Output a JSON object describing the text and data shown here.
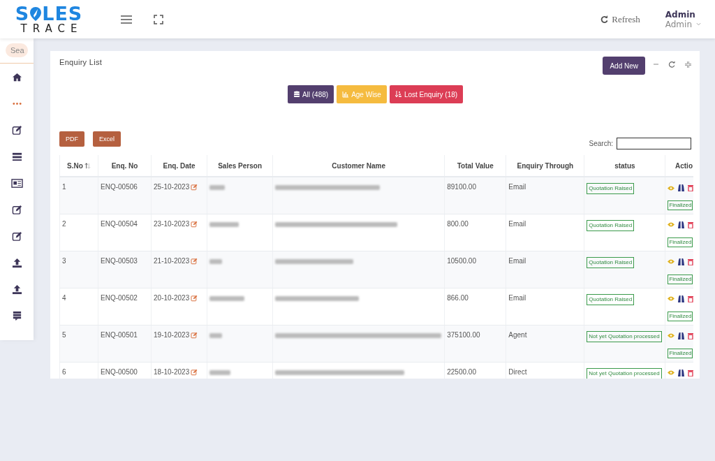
{
  "header": {
    "logo_left": "S",
    "logo_right": "LES",
    "logo_bottom": "TRACE",
    "refresh": "Refresh",
    "user_name": "Admin",
    "user_role": "Admin"
  },
  "sidebar": {
    "search_placeholder": "Sea",
    "items": [
      {
        "kind": "home"
      },
      {
        "kind": "dots"
      },
      {
        "kind": "edit"
      },
      {
        "kind": "list"
      },
      {
        "kind": "news"
      },
      {
        "kind": "edit"
      },
      {
        "kind": "edit"
      },
      {
        "kind": "upload"
      },
      {
        "kind": "upload"
      },
      {
        "kind": "stack"
      }
    ]
  },
  "card": {
    "title": "Enquiry List",
    "add_button": "Add New",
    "filters": [
      {
        "label": "All (488)",
        "kind": "database",
        "color": "#533f6e"
      },
      {
        "label": "Age Wise",
        "kind": "chart",
        "color": "#f5bb3f"
      },
      {
        "label": "Lost Enquiry (18)",
        "kind": "sort",
        "color": "#dc3d55"
      }
    ],
    "exports": [
      "PDF",
      "Excel"
    ],
    "search_label": "Search:",
    "columns": [
      "S.No",
      "Enq. No",
      "Enq. Date",
      "Sales Person",
      "Customer Name",
      "Total Value",
      "Enquiry Through",
      "status",
      "Actio"
    ],
    "rows": [
      {
        "sno": "1",
        "enq_no": "ENQ-00506",
        "date": "25-10-2023",
        "total": "89100.00",
        "through": "Email",
        "status": "Quotation Raised",
        "badge": "Finalized"
      },
      {
        "sno": "2",
        "enq_no": "ENQ-00504",
        "date": "23-10-2023",
        "total": "800.00",
        "through": "Email",
        "status": "Quotation Raised",
        "badge": "Finalized"
      },
      {
        "sno": "3",
        "enq_no": "ENQ-00503",
        "date": "21-10-2023",
        "total": "10500.00",
        "through": "Email",
        "status": "Quotation Raised",
        "badge": "Finalized"
      },
      {
        "sno": "4",
        "enq_no": "ENQ-00502",
        "date": "20-10-2023",
        "total": "866.00",
        "through": "Email",
        "status": "Quotation Raised",
        "badge": "Finalized"
      },
      {
        "sno": "5",
        "enq_no": "ENQ-00501",
        "date": "19-10-2023",
        "total": "375100.00",
        "through": "Agent",
        "status": "Not yet Quotation processed",
        "badge": "Finalized"
      },
      {
        "sno": "6",
        "enq_no": "ENQ-00500",
        "date": "18-10-2023",
        "total": "22500.00",
        "through": "Direct",
        "status": "Not yet Quotation processed"
      }
    ]
  }
}
